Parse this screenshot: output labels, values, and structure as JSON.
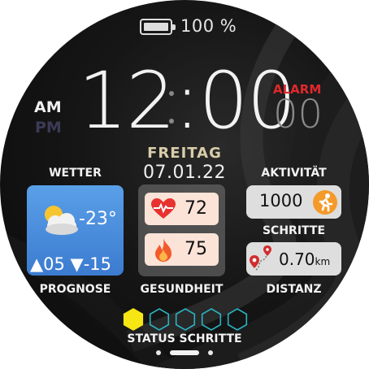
{
  "battery": {
    "percent_text": "100 %",
    "level": 1.0
  },
  "time": {
    "value": "12:00",
    "am": "AM",
    "pm": "PM",
    "active_period": "AM"
  },
  "alarm": {
    "label": "ALARM",
    "value": "00"
  },
  "date": {
    "day": "FREITAG",
    "date": "07.01.22"
  },
  "weather": {
    "label": "WETTER",
    "temperature": "-23°",
    "forecast": "▲05 ▼-15",
    "forecast_label": "PROGNOSE",
    "icon": "partly-cloudy-icon"
  },
  "health": {
    "label": "GESUNDHEIT",
    "heart_rate": "72",
    "calories": "75",
    "heart_icon": "heart-rate-icon",
    "fire_icon": "flame-icon"
  },
  "activity": {
    "label": "AKTIVITÄT",
    "steps": "1000",
    "steps_label": "SCHRITTE",
    "distance": "0.70",
    "distance_unit": "km",
    "distance_label": "DISTANZ"
  },
  "status": {
    "label": "STATUS SCHRITTE",
    "filled": 1,
    "total": 5
  },
  "pager": {
    "pages": 3,
    "active": 1
  },
  "colors": {
    "accent_yellow": "#f5e614",
    "hex_outline": "#2ab3c4",
    "alarm_red": "#e0282c",
    "weather_blue": "#4a8fe0",
    "orange": "#f39a2a"
  }
}
